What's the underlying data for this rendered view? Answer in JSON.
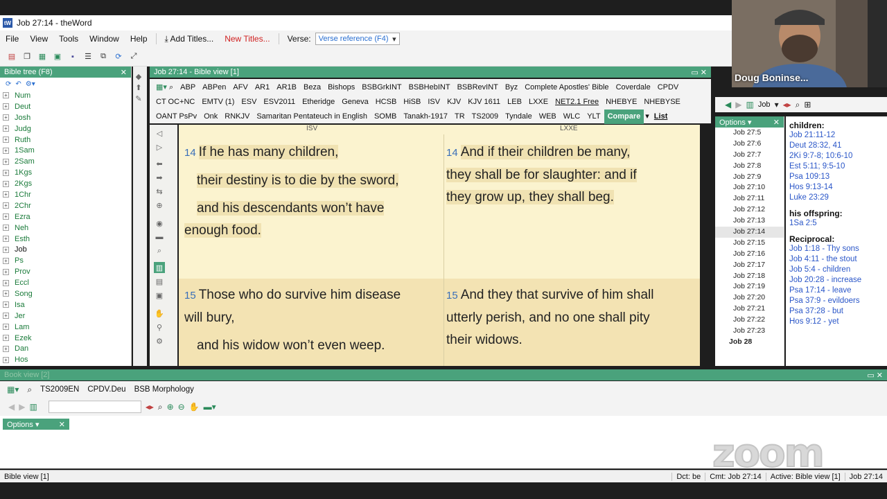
{
  "window": {
    "title": "Job 27:14 - theWord"
  },
  "menu": {
    "items": [
      "File",
      "View",
      "Tools",
      "Window",
      "Help"
    ],
    "add_titles": "Add Titles...",
    "new_titles": "New Titles...",
    "verse_label": "Verse:",
    "verse_ref": "Verse reference (F4)"
  },
  "tree": {
    "title": "Bible tree (F8)",
    "books": [
      "Num",
      "Deut",
      "Josh",
      "Judg",
      "Ruth",
      "1Sam",
      "2Sam",
      "1Kgs",
      "2Kgs",
      "1Chr",
      "2Chr",
      "Ezra",
      "Neh",
      "Esth",
      "Job",
      "Ps",
      "Prov",
      "Eccl",
      "Song",
      "Isa",
      "Jer",
      "Lam",
      "Ezek",
      "Dan",
      "Hos"
    ],
    "selected": "Job"
  },
  "bibleview": {
    "title": "Job 27:14 - Bible view [1]",
    "tabs": [
      "ABP",
      "ABPen",
      "AFV",
      "AR1",
      "AR1B",
      "Beza",
      "Bishops",
      "BSBGrkINT",
      "BSBHebINT",
      "BSBRevINT",
      "Byz",
      "Complete Apostles' Bible",
      "Coverdale",
      "CPDV",
      "CT OC+NC",
      "EMTV (1)",
      "ESV",
      "ESV2011",
      "Etheridge",
      "Geneva",
      "HCSB",
      "HiSB",
      "ISV",
      "KJV",
      "KJV 1611",
      "LEB",
      "LXXE",
      "NET2.1 Free",
      "NHEBYE",
      "NHEBYSE",
      "OANT PsPv",
      "Onk",
      "RNKJV",
      "Samaritan Pentateuch in English",
      "SOMB",
      "Tanakh-1917",
      "TR",
      "TS2009",
      "Tyndale",
      "WEB",
      "WLC",
      "YLT"
    ],
    "current_tab": "NET2.1 Free",
    "compare": "Compare",
    "list": "List",
    "left_col": "ISV",
    "right_col": "LXXE",
    "v14_num": "14",
    "v14_isv_1": "If he has many children,",
    "v14_isv_2": "their destiny is to die by the sword,",
    "v14_isv_3": "and his descendants won’t have",
    "v14_isv_4": "enough food.",
    "v14_lxxe_1": "And if their children be many,",
    "v14_lxxe_2": "they shall be for slaughter: and if",
    "v14_lxxe_3": "they grow up, they shall beg.",
    "v15_num": "15",
    "v15_isv_1": "Those who do survive him disease",
    "v15_isv_2": "will bury,",
    "v15_isv_3": "and his widow won’t even weep.",
    "v15_lxxe_1": "And they that survive of him shall",
    "v15_lxxe_2": "utterly perish, and no one shall pity",
    "v15_lxxe_3": "their widows."
  },
  "versenav": {
    "book": "Job"
  },
  "options": {
    "label": "Options"
  },
  "verselist": {
    "items": [
      "Job 27:5",
      "Job 27:6",
      "Job 27:7",
      "Job 27:8",
      "Job 27:9",
      "Job 27:10",
      "Job 27:11",
      "Job 27:12",
      "Job 27:13",
      "Job 27:14",
      "Job 27:15",
      "Job 27:16",
      "Job 27:17",
      "Job 27:18",
      "Job 27:19",
      "Job 27:20",
      "Job 27:21",
      "Job 27:22",
      "Job 27:23"
    ],
    "selected": "Job 27:14",
    "next_chapter": "Job 28"
  },
  "xrefs": {
    "h1": "children:",
    "r1": [
      "Job 21:11-12",
      "Deut 28:32, 41",
      "2Ki 9:7-8; 10:6-10",
      "Est 5:11; 9:5-10",
      "Psa 109:13",
      "Hos 9:13-14",
      "Luke 23:29"
    ],
    "h2": "his offspring:",
    "r2": [
      "1Sa 2:5"
    ],
    "h3": "Reciprocal:",
    "r3": [
      "Job 1:18 - Thy sons",
      "Job 4:11 - the stout",
      "Job 5:4 - children",
      "Job 20:28 - increase",
      "Psa 17:14 - leave",
      "Psa 37:9 - evildoers",
      "Psa 37:28 - but",
      "Hos 9:12 - yet"
    ]
  },
  "webcam": {
    "name": "Doug Boninse..."
  },
  "bookview": {
    "title": "Book view [2]",
    "tabs": [
      "TS2009EN",
      "CPDV.Deu",
      "BSB Morphology"
    ],
    "options": "Options"
  },
  "zoom_watermark": "zoom",
  "status": {
    "left": "Bible view [1]",
    "dct": "Dct: be",
    "cmt": "Cmt: Job 27:14",
    "active": "Active: Bible view [1]",
    "ref": "Job 27:14"
  }
}
